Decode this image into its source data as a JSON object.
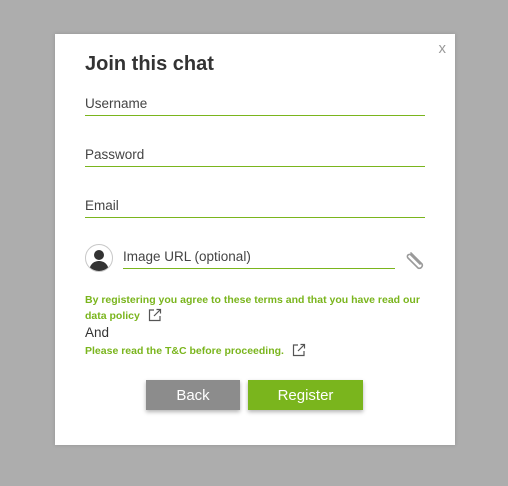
{
  "dialog": {
    "title": "Join this chat",
    "close_label": "x"
  },
  "form": {
    "username_placeholder": "Username",
    "password_placeholder": "Password",
    "email_placeholder": "Email",
    "image_url_placeholder": "Image URL (optional)"
  },
  "terms": {
    "agreement_text": "By registering you agree to these terms and that you have read our",
    "data_policy_link": "data policy",
    "and_text": "And",
    "tc_text": "Please read the T&C before proceeding."
  },
  "buttons": {
    "back_label": "Back",
    "register_label": "Register"
  },
  "colors": {
    "accent": "#7ab51d",
    "back_button": "#8c8c8c",
    "overlay": "#adadad"
  },
  "icons": {
    "avatar": "user-avatar-icon",
    "attach": "paperclip-icon",
    "external_link": "external-link-icon"
  }
}
